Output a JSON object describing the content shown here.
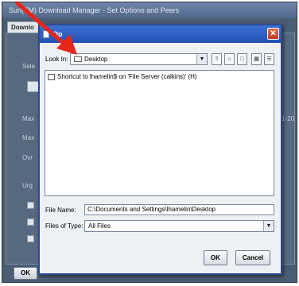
{
  "background_window": {
    "title": "Sun(TM) Download Manager - Set Options and Peers",
    "tab_label": "Downlo",
    "labels": [
      "Sele",
      "Max",
      "Max",
      "Ovr",
      "Urg"
    ],
    "range_text": "1-20",
    "ok_label": "OK"
  },
  "dialog": {
    "title": "Op",
    "close_glyph": "✕",
    "look_in_label": "Look In:",
    "look_in_value": "Desktop",
    "combo_arrow": "▼",
    "toolbar_glyphs": [
      "⇧",
      "⌂",
      "□",
      "▦",
      "☰"
    ],
    "file_list": [
      "Shortcut to lhamelin$ on 'File Server (calkins)' (H)"
    ],
    "file_name_label": "File Name:",
    "file_name_value": "C:\\Documents and Settings\\lhamelin\\Desktop",
    "files_of_type_label": "Files of Type:",
    "files_of_type_value": "All Files",
    "ok_label": "OK",
    "cancel_label": "Cancel"
  },
  "colors": {
    "annotation_arrow": "#e8261c",
    "title_bar": "#2452b4"
  }
}
